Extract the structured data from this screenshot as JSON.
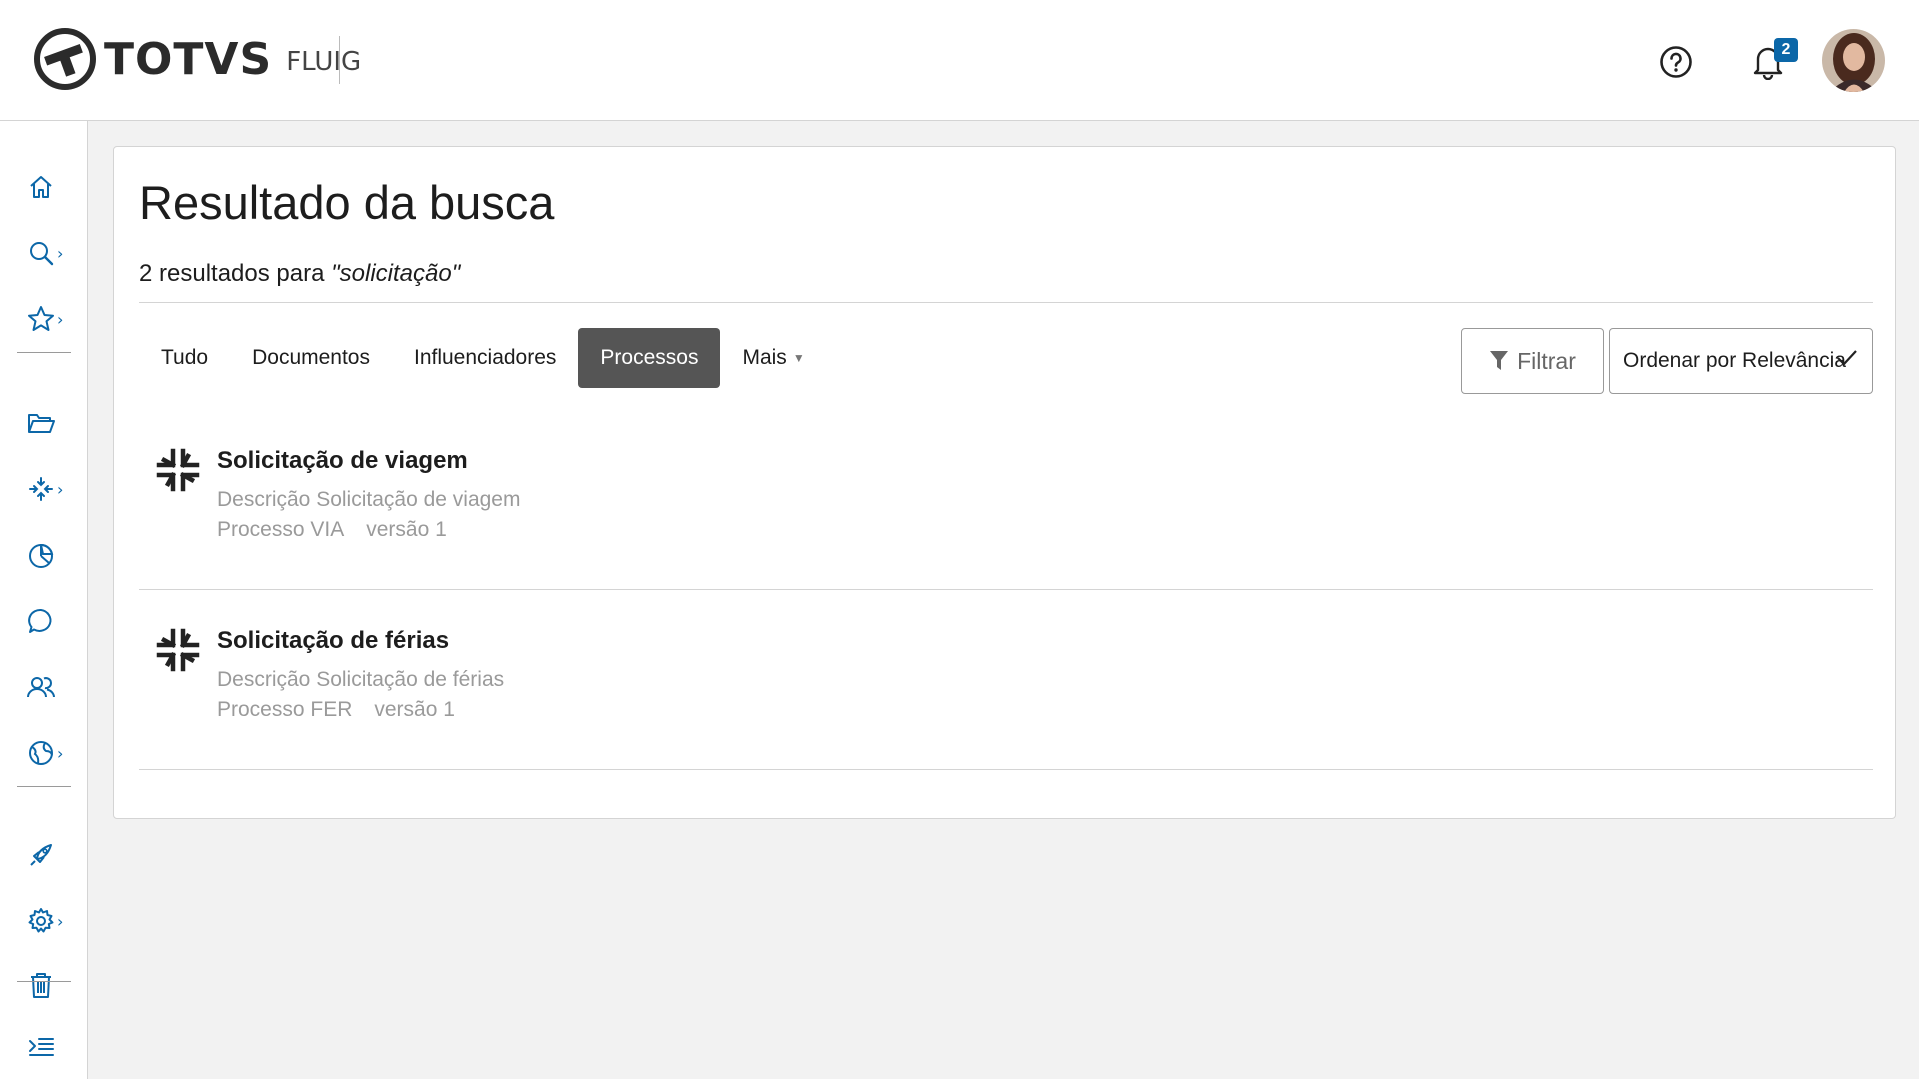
{
  "header": {
    "logo_text": "TOTVS",
    "logo_sub": "FLUIG",
    "notifications_count": "2"
  },
  "sidebar": {
    "items": [
      {
        "name": "home",
        "icon": "home-icon",
        "has_submenu": false
      },
      {
        "name": "search",
        "icon": "search-icon",
        "has_submenu": true
      },
      {
        "name": "favorites",
        "icon": "star-icon",
        "has_submenu": true
      },
      {
        "name": "documents",
        "icon": "folder-open-icon",
        "has_submenu": false
      },
      {
        "name": "processes",
        "icon": "process-arrows-icon",
        "has_submenu": true
      },
      {
        "name": "analytics",
        "icon": "pie-chart-icon",
        "has_submenu": false
      },
      {
        "name": "messages",
        "icon": "chat-bubble-icon",
        "has_submenu": false
      },
      {
        "name": "communities",
        "icon": "users-icon",
        "has_submenu": false
      },
      {
        "name": "sites",
        "icon": "globe-icon",
        "has_submenu": true
      },
      {
        "name": "launch",
        "icon": "rocket-icon",
        "has_submenu": false
      },
      {
        "name": "settings",
        "icon": "gear-icon",
        "has_submenu": true
      },
      {
        "name": "trash",
        "icon": "trash-icon",
        "has_submenu": false
      },
      {
        "name": "collapse-menu",
        "icon": "menu-indent-icon",
        "has_submenu": false
      }
    ],
    "chevron": "›"
  },
  "main": {
    "title": "Resultado da busca",
    "subtitle_prefix": "2 resultados para ",
    "query": "\"solicitação\"",
    "tabs": [
      {
        "label": "Tudo",
        "active": false
      },
      {
        "label": "Documentos",
        "active": false
      },
      {
        "label": "Influenciadores",
        "active": false
      },
      {
        "label": "Processos",
        "active": true
      },
      {
        "label": "Mais",
        "active": false,
        "dropdown": true
      }
    ],
    "filter_label": "Filtrar",
    "order_label": "Ordenar por Relevância",
    "results": [
      {
        "title": "Solicitação de viagem",
        "description": "Descrição Solicitação de viagem",
        "process": "Processo VIA",
        "version": "versão 1"
      },
      {
        "title": "Solicitação de férias",
        "description": "Descrição Solicitação de férias",
        "process": "Processo FER",
        "version": "versão 1"
      }
    ]
  },
  "colors": {
    "accent": "#0c67a8",
    "active_tab": "#555555",
    "muted_text": "#9a9a9a"
  }
}
